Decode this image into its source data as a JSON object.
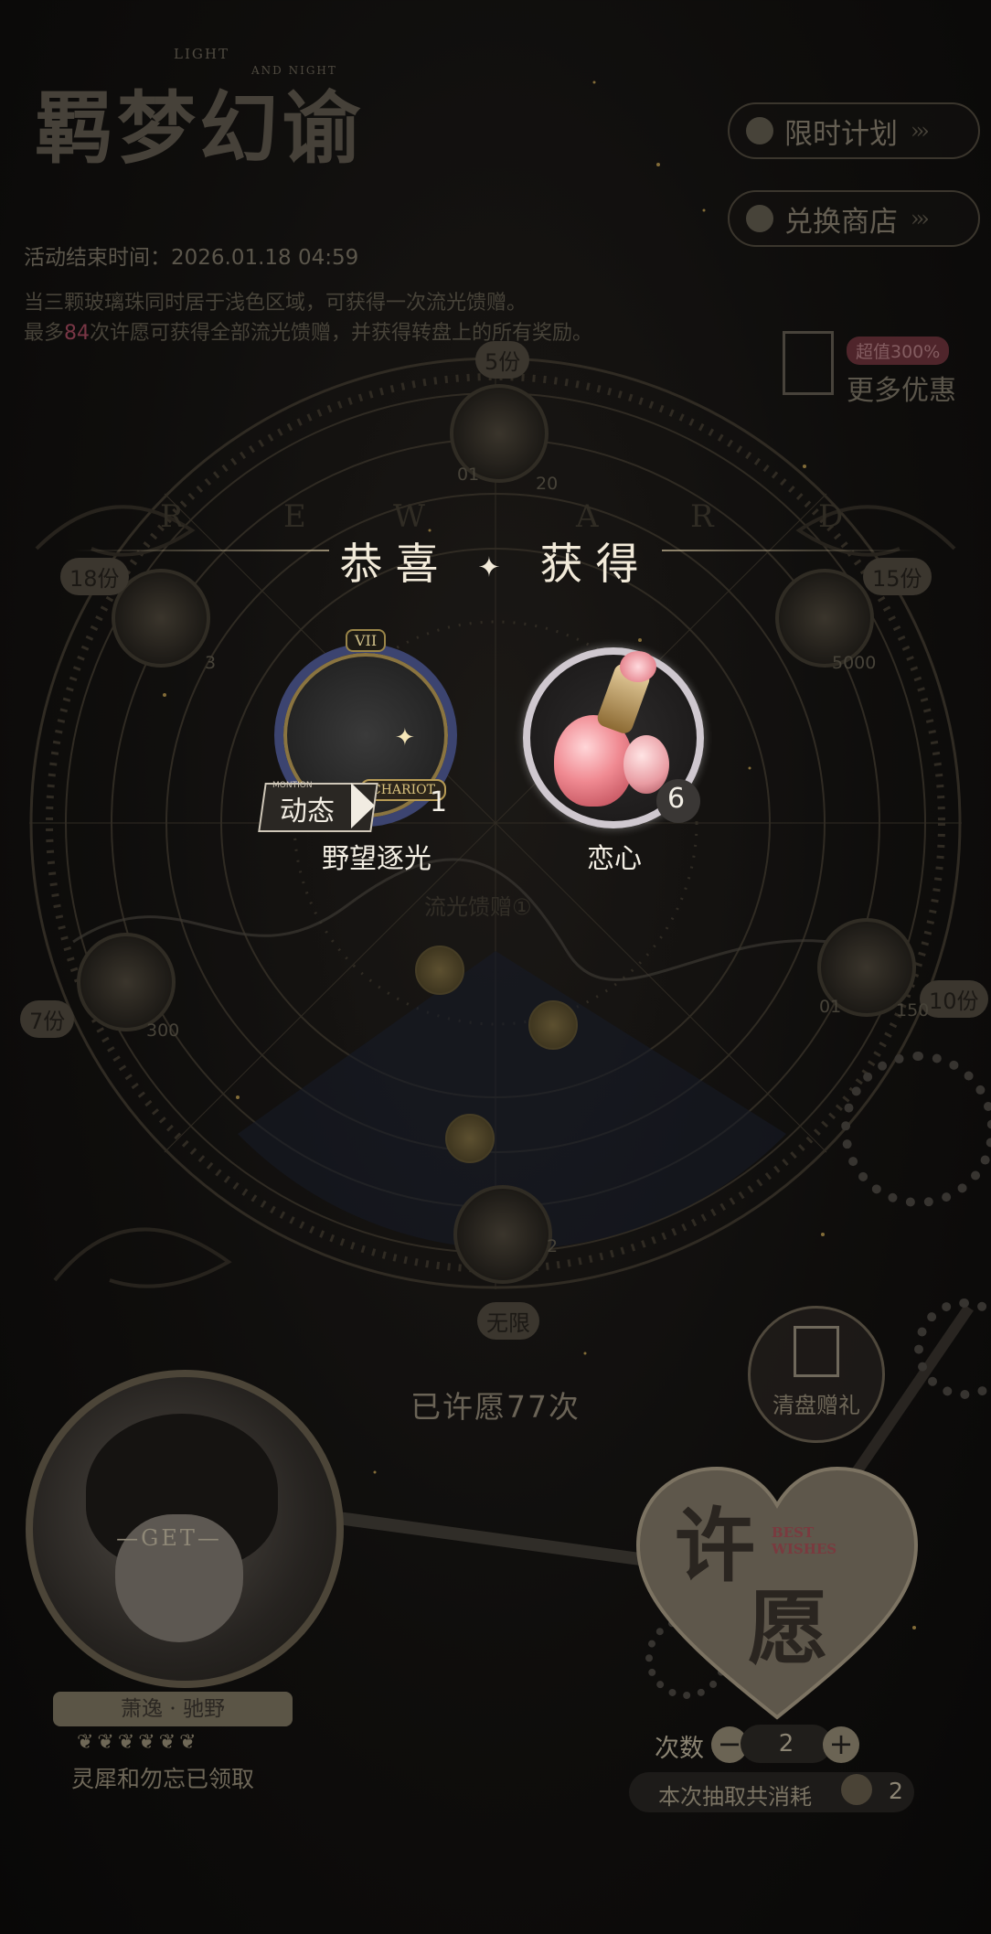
{
  "logo": {
    "title": "羁梦幻谕",
    "sub_light": "LIGHT",
    "sub_night": "AND NIGHT"
  },
  "event": {
    "end_time": "活动结束时间：2026.01.18 04:59",
    "desc_line1": "当三颗玻璃珠同时居于浅色区域，可获得一次流光馈赠。",
    "desc_line2_prefix": "最多",
    "desc_line2_highlight": "84",
    "desc_line2_suffix": "次许愿可获得全部流光馈赠，并获得转盘上的所有奖励。"
  },
  "side_buttons": {
    "limited_plan": "限时计划",
    "exchange_shop": "兑换商店",
    "arrows": "›››"
  },
  "promo": {
    "badge": "超值300%",
    "label": "更多优惠"
  },
  "wheel": {
    "reward_letters": [
      "R",
      "E",
      "W",
      "A",
      "R",
      "D"
    ],
    "nodes": [
      {
        "share": "5份",
        "count": "20"
      },
      {
        "share": "18份",
        "count": "3"
      },
      {
        "share": "15份",
        "count": "5000"
      },
      {
        "share": "7份",
        "count": "300"
      },
      {
        "share": "10份",
        "count": "150"
      },
      {
        "share": "无限",
        "count": "2"
      }
    ],
    "chip_01": "01",
    "gift_label": "流光馈赠①"
  },
  "popup": {
    "title": "恭喜",
    "diamond": "✦",
    "title2": "获得",
    "items": [
      {
        "name": "野望逐光",
        "qty": "1",
        "tag": "动态",
        "plate": "CHARIOT",
        "top_label": "VII",
        "small": "MONTION"
      },
      {
        "name": "恋心",
        "qty": "6"
      }
    ]
  },
  "wish_count": "已许愿77次",
  "character": {
    "get_label": "—GET—",
    "name": "萧逸 · 驰野",
    "leaves": "❦❦❦❦❦❦",
    "status": "灵犀和勿忘已领取"
  },
  "clear_gift": {
    "label": "清盘赠礼"
  },
  "wish_button": {
    "label_top": "许",
    "label_bottom": "愿",
    "en_top": "BEST",
    "en_bottom": "WISHES"
  },
  "draw": {
    "count_label": "次数",
    "minus": "−",
    "plus": "+",
    "count_value": "2",
    "cost_label": "本次抽取共消耗",
    "cost_value": "2"
  },
  "colors": {
    "accent_gold": "#c9b27a",
    "highlight_pink": "#b8546b",
    "potion_pink": "#f08a92"
  }
}
